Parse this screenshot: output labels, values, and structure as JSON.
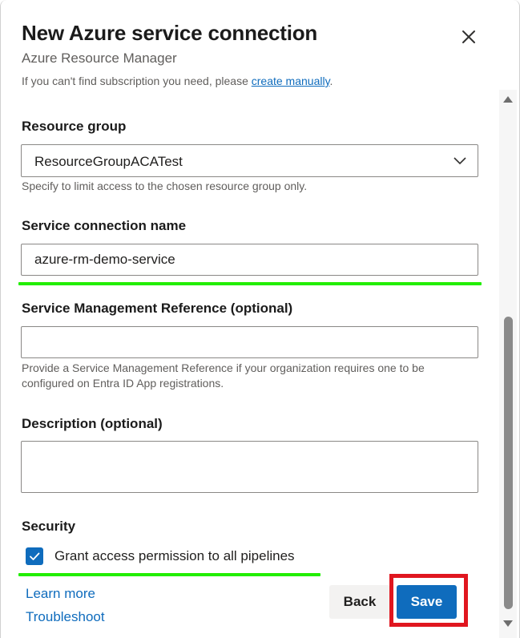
{
  "dialog": {
    "title": "New Azure service connection",
    "subtitle": "Azure Resource Manager",
    "close_icon": "close-icon"
  },
  "cut_off_hint": {
    "text": "If you can't find subscription you need, please ",
    "link": "create manually",
    "suffix": "."
  },
  "resource_group": {
    "label": "Resource group",
    "value": "ResourceGroupACATest",
    "help": "Specify to limit access to the chosen resource group only."
  },
  "service_connection_name": {
    "label": "Service connection name",
    "value": "azure-rm-demo-service"
  },
  "service_management_reference": {
    "label": "Service Management Reference (optional)",
    "value": "",
    "help_line1": "Provide a Service Management Reference if your organization requires one to be",
    "help_line2": "configured on Entra ID App registrations."
  },
  "description": {
    "label": "Description (optional)",
    "value": ""
  },
  "security": {
    "label": "Security",
    "checkbox_checked": true,
    "checkbox_label": "Grant access permission to all pipelines"
  },
  "links": {
    "learn_more": "Learn more",
    "troubleshoot": "Troubleshoot"
  },
  "buttons": {
    "back": "Back",
    "save": "Save"
  },
  "colors": {
    "accent": "#0f6cbd",
    "highlight_green": "#22ee00",
    "highlight_red": "#e0161f"
  }
}
